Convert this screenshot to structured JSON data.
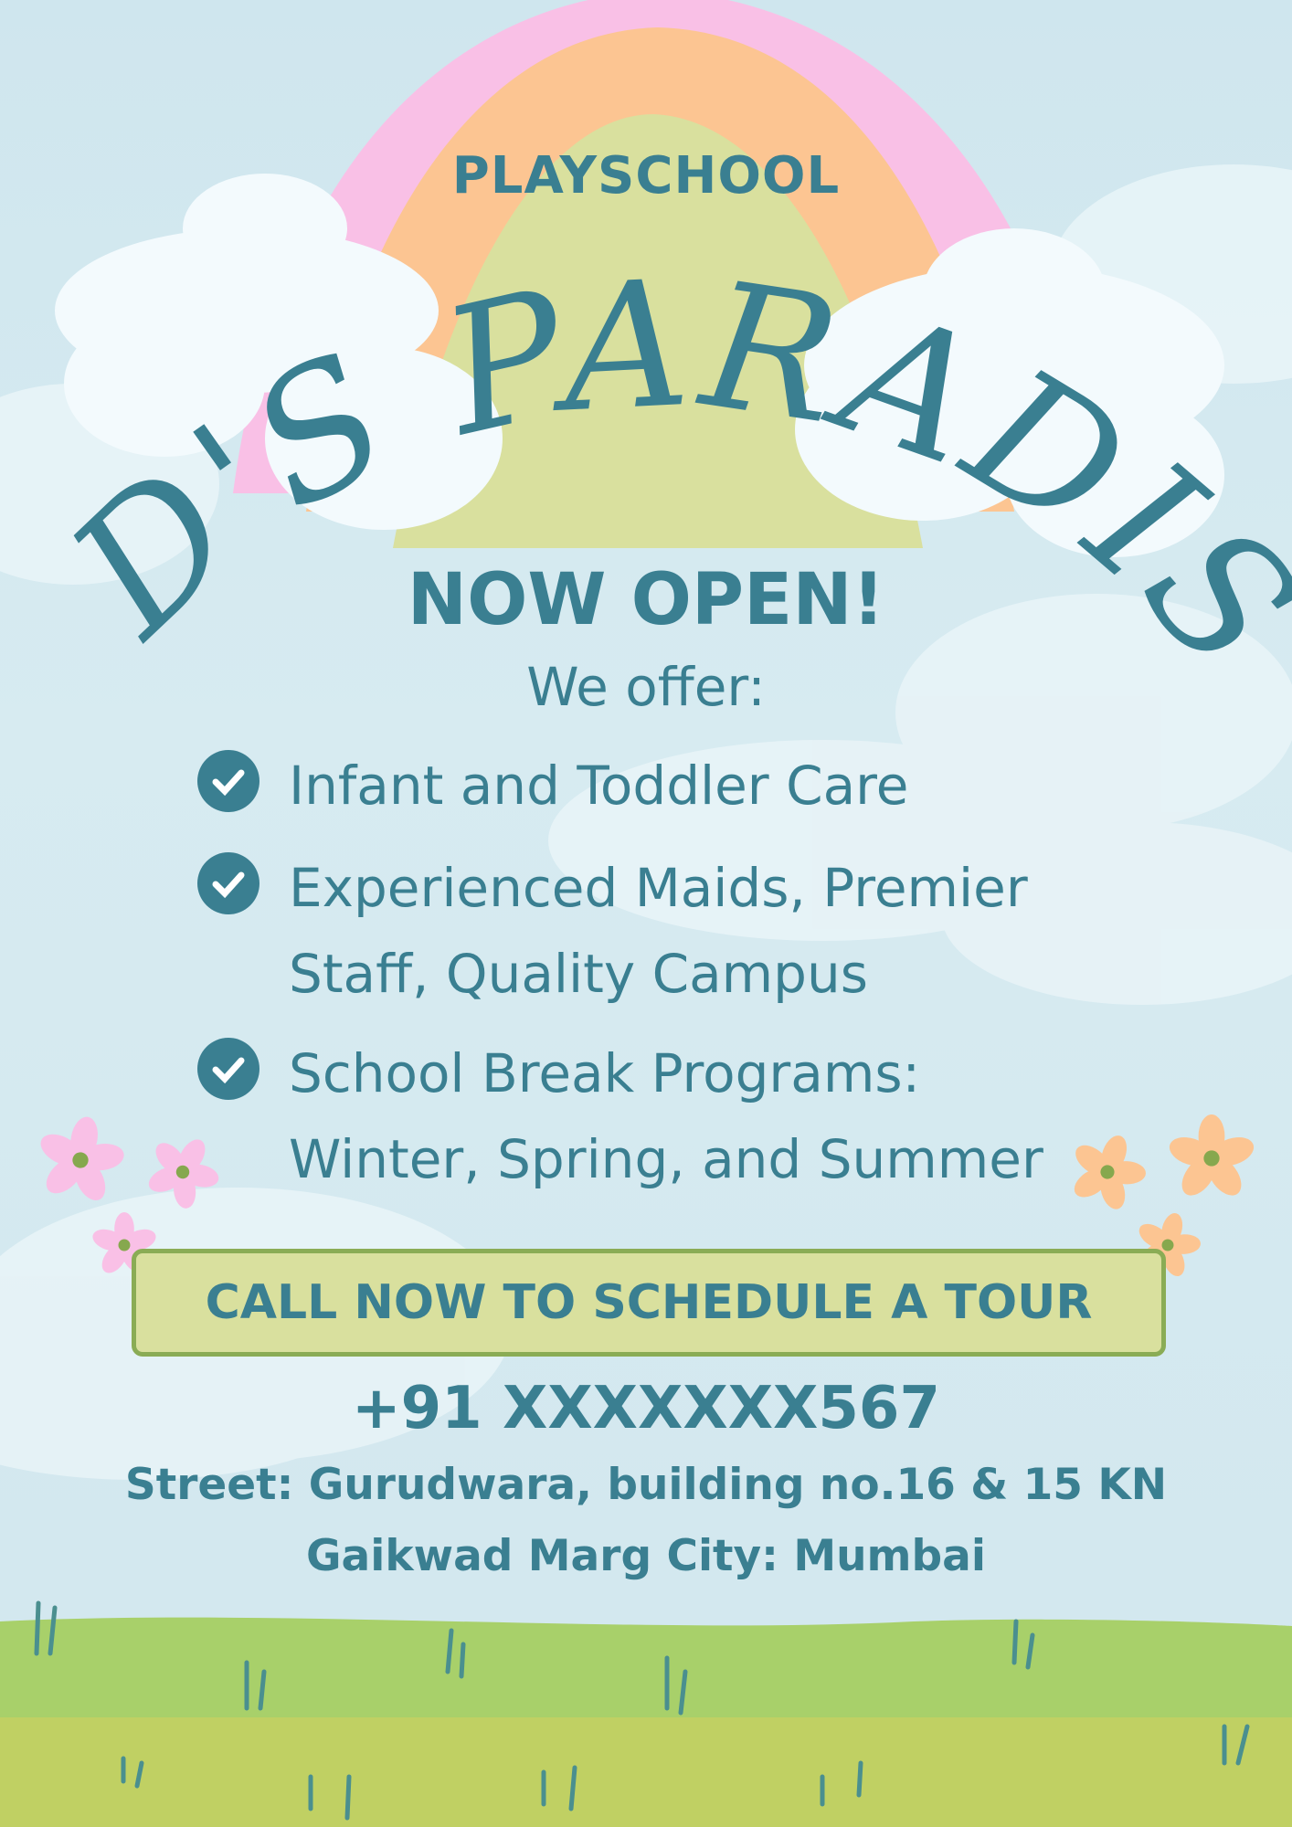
{
  "header": {
    "eyebrow": "PLAYSCHOOL",
    "title": "KID'S PARADISE"
  },
  "announcement": "NOW OPEN!",
  "offer_heading": "We offer:",
  "offers": [
    {
      "lines": [
        "Infant and Toddler Care"
      ]
    },
    {
      "lines": [
        "Experienced Maids, Premier",
        "Staff, Quality Campus"
      ]
    },
    {
      "lines": [
        "School Break Programs:",
        "Winter, Spring, and Summer"
      ]
    }
  ],
  "cta_label": "CALL NOW TO SCHEDULE A TOUR",
  "contact": {
    "phone": "+91 XXXXXXX567",
    "address_line1": "Street: Gurudwara, building no.16 & 15 KN",
    "address_line2": "Gaikwad Marg City: Mumbai"
  },
  "colors": {
    "text": "#3a7f91",
    "rainbow": [
      "#f9c0e6",
      "#fcc592",
      "#d9e09e"
    ],
    "button": "#d9e09e",
    "button_border": "#8aac55",
    "grass": "#a8d06a"
  },
  "icons": [
    "check-circle-icon",
    "flower-icon",
    "cloud-icon",
    "rainbow-icon",
    "grass-icon"
  ]
}
